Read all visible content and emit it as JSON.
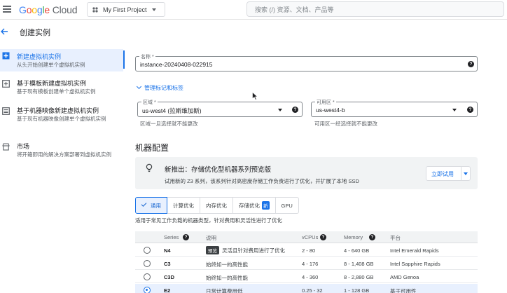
{
  "topbar": {
    "logo_google": [
      "G",
      "o",
      "o",
      "g",
      "l",
      "e"
    ],
    "logo_cloud": "Cloud",
    "project_name": "My First Project",
    "search_placeholder": "搜索 (/) 资源、文档、产品等"
  },
  "page": {
    "title": "创建实例"
  },
  "sidebar": {
    "items": [
      {
        "title": "新建虚拟机实例",
        "desc": "从头开始创建单个虚拟机实例",
        "icon": "add-box-icon",
        "active": true
      },
      {
        "title": "基于模板新建虚拟机实例",
        "desc": "基于现有模板创建单个虚拟机实例",
        "icon": "template-icon"
      },
      {
        "title": "基于机器映像新建虚拟机实例",
        "desc": "基于现有机器映像创建单个虚拟机实例",
        "icon": "machine-image-icon"
      },
      {
        "title": "市场",
        "desc": "将开箱即用的解决方案部署到虚拟机实例",
        "icon": "marketplace-icon"
      }
    ]
  },
  "form": {
    "name_label": "名称 *",
    "name_value": "instance-20240408-022915",
    "manage_tags_link": "管理标记和标签",
    "region_label": "区域 *",
    "region_value": "us-west4 (拉斯维加斯)",
    "region_hint": "区域一旦选择就不能更改",
    "zone_label": "可用区 *",
    "zone_value": "us-west4-b",
    "zone_hint": "可用区一经选择就不能更改",
    "help": "?"
  },
  "machine": {
    "section_title": "机器配置",
    "banner_title": "新推出：存储优化型机器系列预览版",
    "banner_desc": "试用新的 Z3 系列，该系列针对高密度存储工作负责进行了优化，并扩展了本地 SSD",
    "banner_button": "立即试用",
    "tabs": [
      "通用",
      "计算优化",
      "内存优化",
      "存储优化",
      "GPU"
    ],
    "new_badge": "新",
    "tab_desc": "适用于常见工作负载的机器类型，针对费用和灵活性进行了优化"
  },
  "table": {
    "headers": {
      "series": "Series",
      "desc": "说明",
      "vcpus": "vCPUs",
      "memory": "Memory",
      "platform": "平台"
    },
    "preview_tag": "预览",
    "rows": [
      {
        "series": "N4",
        "desc": "灵活且针对费用进行了优化",
        "preview": true,
        "vcpus": "2 - 80",
        "memory": "4 - 640 GB",
        "platform": "Intel Emerald Rapids",
        "selected": false
      },
      {
        "series": "C3",
        "desc": "始终如一的高性能",
        "vcpus": "4 - 176",
        "memory": "8 - 1,408 GB",
        "platform": "Intel Sapphire Rapids",
        "selected": false
      },
      {
        "series": "C3D",
        "desc": "始终如一的高性能",
        "vcpus": "4 - 360",
        "memory": "8 - 2,880 GB",
        "platform": "AMD Genoa",
        "selected": false
      },
      {
        "series": "E2",
        "desc": "日常计算费用低",
        "vcpus": "0.25 - 32",
        "memory": "1 - 128 GB",
        "platform": "基于可用性",
        "selected": true
      }
    ]
  },
  "colors": {
    "accent": "#1a73e8",
    "active_bg": "#e8f0fe"
  }
}
